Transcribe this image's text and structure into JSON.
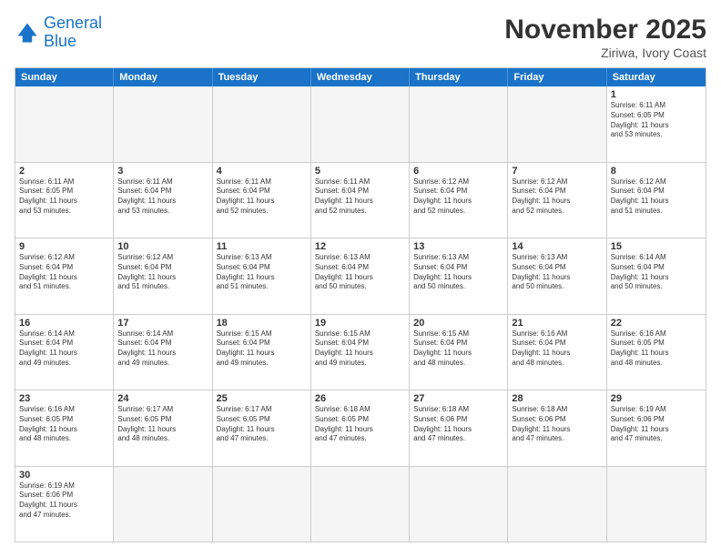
{
  "header": {
    "logo_general": "General",
    "logo_blue": "Blue",
    "month_title": "November 2025",
    "location": "Ziriwa, Ivory Coast"
  },
  "days_of_week": [
    "Sunday",
    "Monday",
    "Tuesday",
    "Wednesday",
    "Thursday",
    "Friday",
    "Saturday"
  ],
  "weeks": [
    [
      {
        "day": "",
        "empty": true,
        "text": ""
      },
      {
        "day": "",
        "empty": true,
        "text": ""
      },
      {
        "day": "",
        "empty": true,
        "text": ""
      },
      {
        "day": "",
        "empty": true,
        "text": ""
      },
      {
        "day": "",
        "empty": true,
        "text": ""
      },
      {
        "day": "",
        "empty": true,
        "text": ""
      },
      {
        "day": "1",
        "empty": false,
        "text": "Sunrise: 6:11 AM\nSunset: 6:05 PM\nDaylight: 11 hours\nand 53 minutes."
      }
    ],
    [
      {
        "day": "2",
        "empty": false,
        "text": "Sunrise: 6:11 AM\nSunset: 6:05 PM\nDaylight: 11 hours\nand 53 minutes."
      },
      {
        "day": "3",
        "empty": false,
        "text": "Sunrise: 6:11 AM\nSunset: 6:04 PM\nDaylight: 11 hours\nand 53 minutes."
      },
      {
        "day": "4",
        "empty": false,
        "text": "Sunrise: 6:11 AM\nSunset: 6:04 PM\nDaylight: 11 hours\nand 52 minutes."
      },
      {
        "day": "5",
        "empty": false,
        "text": "Sunrise: 6:11 AM\nSunset: 6:04 PM\nDaylight: 11 hours\nand 52 minutes."
      },
      {
        "day": "6",
        "empty": false,
        "text": "Sunrise: 6:12 AM\nSunset: 6:04 PM\nDaylight: 11 hours\nand 52 minutes."
      },
      {
        "day": "7",
        "empty": false,
        "text": "Sunrise: 6:12 AM\nSunset: 6:04 PM\nDaylight: 11 hours\nand 52 minutes."
      },
      {
        "day": "8",
        "empty": false,
        "text": "Sunrise: 6:12 AM\nSunset: 6:04 PM\nDaylight: 11 hours\nand 51 minutes."
      }
    ],
    [
      {
        "day": "9",
        "empty": false,
        "text": "Sunrise: 6:12 AM\nSunset: 6:04 PM\nDaylight: 11 hours\nand 51 minutes."
      },
      {
        "day": "10",
        "empty": false,
        "text": "Sunrise: 6:12 AM\nSunset: 6:04 PM\nDaylight: 11 hours\nand 51 minutes."
      },
      {
        "day": "11",
        "empty": false,
        "text": "Sunrise: 6:13 AM\nSunset: 6:04 PM\nDaylight: 11 hours\nand 51 minutes."
      },
      {
        "day": "12",
        "empty": false,
        "text": "Sunrise: 6:13 AM\nSunset: 6:04 PM\nDaylight: 11 hours\nand 50 minutes."
      },
      {
        "day": "13",
        "empty": false,
        "text": "Sunrise: 6:13 AM\nSunset: 6:04 PM\nDaylight: 11 hours\nand 50 minutes."
      },
      {
        "day": "14",
        "empty": false,
        "text": "Sunrise: 6:13 AM\nSunset: 6:04 PM\nDaylight: 11 hours\nand 50 minutes."
      },
      {
        "day": "15",
        "empty": false,
        "text": "Sunrise: 6:14 AM\nSunset: 6:04 PM\nDaylight: 11 hours\nand 50 minutes."
      }
    ],
    [
      {
        "day": "16",
        "empty": false,
        "text": "Sunrise: 6:14 AM\nSunset: 6:04 PM\nDaylight: 11 hours\nand 49 minutes."
      },
      {
        "day": "17",
        "empty": false,
        "text": "Sunrise: 6:14 AM\nSunset: 6:04 PM\nDaylight: 11 hours\nand 49 minutes."
      },
      {
        "day": "18",
        "empty": false,
        "text": "Sunrise: 6:15 AM\nSunset: 6:04 PM\nDaylight: 11 hours\nand 49 minutes."
      },
      {
        "day": "19",
        "empty": false,
        "text": "Sunrise: 6:15 AM\nSunset: 6:04 PM\nDaylight: 11 hours\nand 49 minutes."
      },
      {
        "day": "20",
        "empty": false,
        "text": "Sunrise: 6:15 AM\nSunset: 6:04 PM\nDaylight: 11 hours\nand 48 minutes."
      },
      {
        "day": "21",
        "empty": false,
        "text": "Sunrise: 6:16 AM\nSunset: 6:04 PM\nDaylight: 11 hours\nand 48 minutes."
      },
      {
        "day": "22",
        "empty": false,
        "text": "Sunrise: 6:16 AM\nSunset: 6:05 PM\nDaylight: 11 hours\nand 48 minutes."
      }
    ],
    [
      {
        "day": "23",
        "empty": false,
        "text": "Sunrise: 6:16 AM\nSunset: 6:05 PM\nDaylight: 11 hours\nand 48 minutes."
      },
      {
        "day": "24",
        "empty": false,
        "text": "Sunrise: 6:17 AM\nSunset: 6:05 PM\nDaylight: 11 hours\nand 48 minutes."
      },
      {
        "day": "25",
        "empty": false,
        "text": "Sunrise: 6:17 AM\nSunset: 6:05 PM\nDaylight: 11 hours\nand 47 minutes."
      },
      {
        "day": "26",
        "empty": false,
        "text": "Sunrise: 6:18 AM\nSunset: 6:05 PM\nDaylight: 11 hours\nand 47 minutes."
      },
      {
        "day": "27",
        "empty": false,
        "text": "Sunrise: 6:18 AM\nSunset: 6:06 PM\nDaylight: 11 hours\nand 47 minutes."
      },
      {
        "day": "28",
        "empty": false,
        "text": "Sunrise: 6:18 AM\nSunset: 6:06 PM\nDaylight: 11 hours\nand 47 minutes."
      },
      {
        "day": "29",
        "empty": false,
        "text": "Sunrise: 6:19 AM\nSunset: 6:06 PM\nDaylight: 11 hours\nand 47 minutes."
      }
    ],
    [
      {
        "day": "30",
        "empty": false,
        "text": "Sunrise: 6:19 AM\nSunset: 6:06 PM\nDaylight: 11 hours\nand 47 minutes."
      },
      {
        "day": "",
        "empty": true,
        "text": ""
      },
      {
        "day": "",
        "empty": true,
        "text": ""
      },
      {
        "day": "",
        "empty": true,
        "text": ""
      },
      {
        "day": "",
        "empty": true,
        "text": ""
      },
      {
        "day": "",
        "empty": true,
        "text": ""
      },
      {
        "day": "",
        "empty": true,
        "text": ""
      }
    ]
  ]
}
